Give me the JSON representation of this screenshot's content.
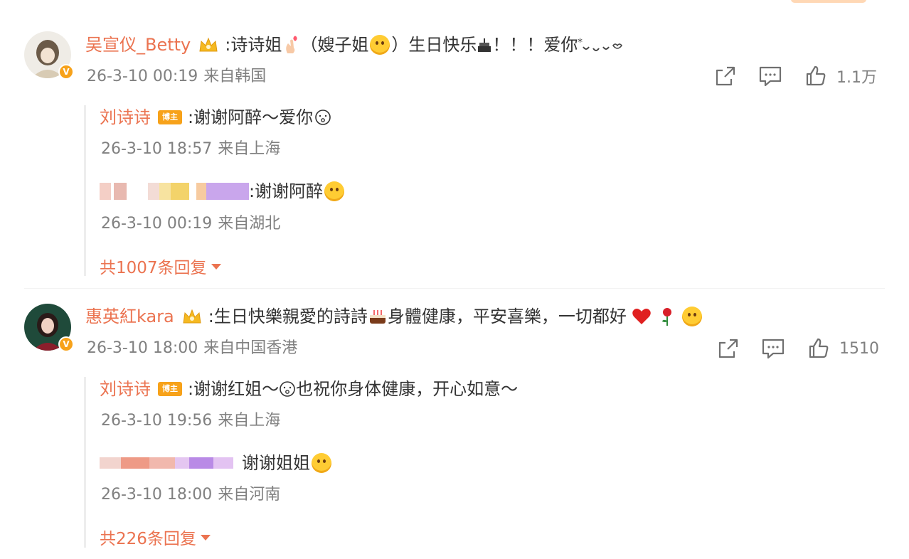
{
  "comments": [
    {
      "username": "吴宣仪_Betty",
      "text_a": ":诗诗姐",
      "text_b": "（嫂子姐",
      "text_c": "）生日快乐",
      "text_d": "！！！爱你",
      "time": "26-3-10 00:19",
      "source": "来自韩国",
      "likes": "1.1万",
      "replies": [
        {
          "username": "刘诗诗",
          "badge": "博主",
          "text": ":谢谢阿醉～爱你",
          "time": "26-3-10 18:57",
          "source": "来自上海"
        },
        {
          "text": ":谢谢阿醉",
          "time": "26-3-10 00:19",
          "source": "来自湖北"
        }
      ],
      "more_replies": "共1007条回复"
    },
    {
      "username": "惠英紅kara",
      "text_a": ":生日快樂親愛的詩詩",
      "text_b": "身體健康，平安喜樂，一切都好",
      "time": "26-3-10 18:00",
      "source": "来自中国香港",
      "likes": "1510",
      "replies": [
        {
          "username": "刘诗诗",
          "badge": "博主",
          "text_a": ":谢谢红姐～",
          "text_b": "也祝你身体健康，开心如意～",
          "time": "26-3-10 19:56",
          "source": "来自上海"
        },
        {
          "text": "谢谢姐姐",
          "time": "26-3-10 18:00",
          "source": "来自河南"
        }
      ],
      "more_replies": "共226条回复"
    }
  ],
  "colors": {
    "accent": "#eb7350",
    "meta": "#808080",
    "badge": "#f7a21a"
  },
  "icons": [
    "verified-v-icon",
    "crown-icon",
    "share-icon",
    "comment-icon",
    "like-icon",
    "caret-down-icon"
  ]
}
